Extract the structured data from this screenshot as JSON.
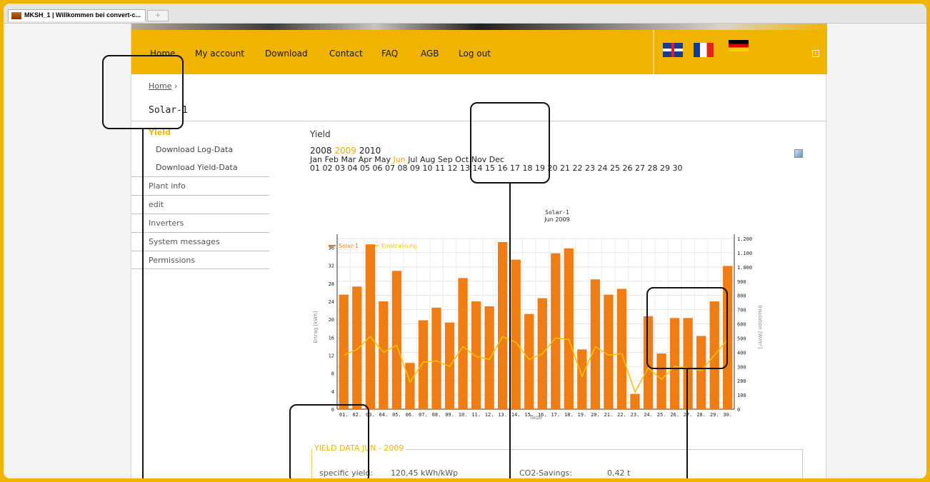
{
  "browser": {
    "tab_title": "MKSH_1 | Willkommen bei convert-c...",
    "new_tab_label": "+"
  },
  "nav": {
    "items": [
      "Home",
      "My account",
      "Download",
      "Contact",
      "FAQ",
      "AGB",
      "Log out"
    ],
    "languages": [
      "English",
      "Français",
      "Deutsch"
    ],
    "info_icon": "i"
  },
  "breadcrumb": {
    "home": "Home",
    "separator": "›"
  },
  "plant_title": "Solar-1",
  "sidebar": {
    "active": "Yield",
    "sub_items": [
      "Download Log-Data",
      "Download Yield-Data"
    ],
    "items": [
      "Plant info",
      "edit",
      "Inverters",
      "System messages",
      "Permissions"
    ]
  },
  "content": {
    "heading": "Yield",
    "years": [
      "2008",
      "2009",
      "2010"
    ],
    "selected_year": "2009",
    "months": [
      "Jan",
      "Feb",
      "Mar",
      "Apr",
      "May",
      "Jun",
      "Jul",
      "Aug",
      "Sep",
      "Oct",
      "Nov",
      "Dec"
    ],
    "selected_month": "Jun",
    "days": [
      "01",
      "02",
      "03",
      "04",
      "05",
      "06",
      "07",
      "08",
      "09",
      "10",
      "11",
      "12",
      "13",
      "14",
      "15",
      "16",
      "17",
      "18",
      "19",
      "20",
      "21",
      "22",
      "23",
      "24",
      "25",
      "26",
      "27",
      "28",
      "29",
      "30"
    ]
  },
  "colors": {
    "accent": "#f0b400",
    "bar": "#f07d14",
    "line": "#f5c200"
  },
  "chart_data": {
    "type": "bar",
    "title": "Solar-1",
    "subtitle": "Jun 2009",
    "xlabel": "Tage",
    "ylabel": "Ertrag [kWh]",
    "y2label": "Insolation [W/m²]",
    "legend": [
      "Solar-1",
      "Einstrahlung"
    ],
    "categories": [
      "01.",
      "02.",
      "03.",
      "04.",
      "05.",
      "06.",
      "07.",
      "08.",
      "09.",
      "10.",
      "11.",
      "12.",
      "13.",
      "14.",
      "15.",
      "16.",
      "17.",
      "18.",
      "19.",
      "20.",
      "21.",
      "22.",
      "23.",
      "24.",
      "25.",
      "26.",
      "27.",
      "28.",
      "29.",
      "30."
    ],
    "ylim": [
      0,
      38
    ],
    "yticks": [
      "0",
      "4",
      "8",
      "12",
      "16",
      "20",
      "24",
      "28",
      "32",
      "36"
    ],
    "y2lim": [
      0,
      1200
    ],
    "y2ticks": [
      "0",
      "100",
      "200",
      "300",
      "400",
      "500",
      "600",
      "700",
      "800",
      "900",
      "1.000",
      "1.100",
      "1.200"
    ],
    "series": [
      {
        "name": "Solar-1",
        "axis": "left",
        "values": [
          25.5,
          27.3,
          36.7,
          24.0,
          30.8,
          10.3,
          19.8,
          22.6,
          19.3,
          29.2,
          24.0,
          22.9,
          37.2,
          33.3,
          21.2,
          24.7,
          34.7,
          35.8,
          13.3,
          28.9,
          25.5,
          26.8,
          3.4,
          20.7,
          12.4,
          20.3,
          20.3,
          16.3,
          24.0,
          31.9
        ]
      },
      {
        "name": "Einstrahlung",
        "axis": "right",
        "values": [
          380,
          420,
          510,
          400,
          450,
          190,
          330,
          340,
          300,
          440,
          370,
          350,
          510,
          470,
          350,
          390,
          500,
          490,
          230,
          440,
          380,
          390,
          120,
          290,
          210,
          300,
          290,
          270,
          380,
          490
        ]
      }
    ],
    "grid": true,
    "legend_position": "top-left"
  },
  "yield_box": {
    "title": "YIELD DATA JUN - 2009",
    "specific_yield_label": "specific yield:",
    "specific_yield_value": "120,45 kWh/kWp",
    "co2_label": "CO2-Savings:",
    "co2_value": "0,42 t"
  }
}
